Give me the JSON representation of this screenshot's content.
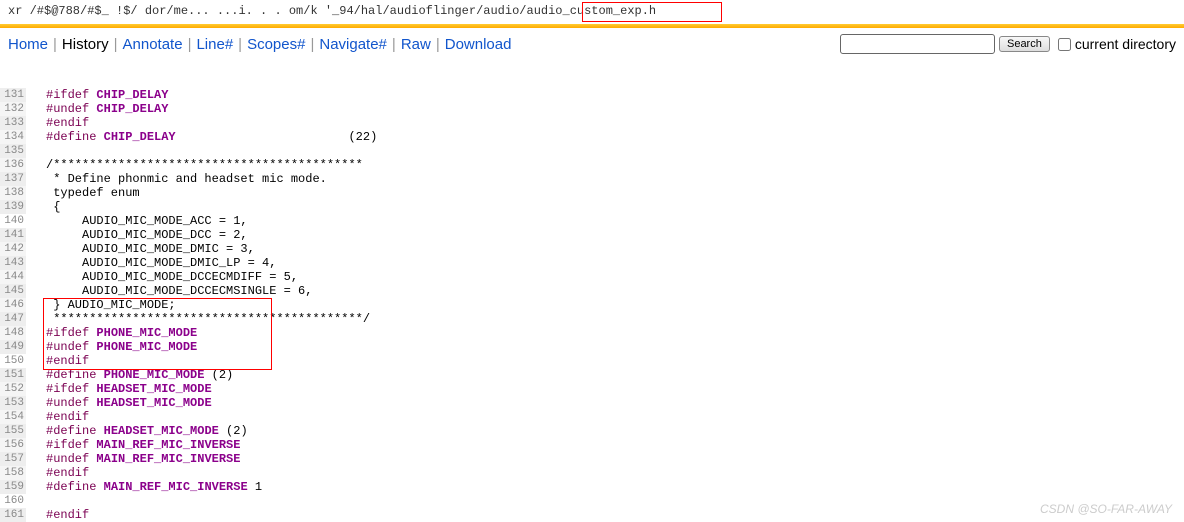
{
  "path": {
    "prefix": "xr   /#$@788/#$_ !$/   dor/me...  ...i.  . . om/k   '_94/hal/audioflinger/audio",
    "highlighted": "/audio_custom_exp.h"
  },
  "nav": {
    "items": [
      "Home",
      "History",
      "Annotate",
      "Line#",
      "Scopes#",
      "Navigate#",
      "Raw",
      "Download"
    ],
    "active_index": 1
  },
  "search": {
    "button": "Search",
    "checkbox_label": "current directory"
  },
  "code_lines": [
    {
      "n": 131,
      "bg": "odd",
      "html": "<span class='kw'>#ifdef</span> <span class='macro'>CHIP_DELAY</span>"
    },
    {
      "n": 132,
      "bg": "even",
      "html": "<span class='kw'>#undef</span> <span class='macro'>CHIP_DELAY</span>"
    },
    {
      "n": 133,
      "bg": "odd",
      "html": "<span class='kw'>#endif</span>"
    },
    {
      "n": 134,
      "bg": "even",
      "html": "<span class='kw'>#define</span> <span class='macro'>CHIP_DELAY</span>                        (22)"
    },
    {
      "n": 135,
      "bg": "odd",
      "html": ""
    },
    {
      "n": 136,
      "bg": "even",
      "html": "/*******************************************"
    },
    {
      "n": 137,
      "bg": "odd",
      "html": " * Define phonmic and headset mic mode."
    },
    {
      "n": 138,
      "bg": "even",
      "html": " typedef enum"
    },
    {
      "n": 139,
      "bg": "odd",
      "html": " {"
    },
    {
      "n": 140,
      "bg": "white",
      "html": "     AUDIO_MIC_MODE_ACC = 1,"
    },
    {
      "n": 141,
      "bg": "odd",
      "html": "     AUDIO_MIC_MODE_DCC = 2,"
    },
    {
      "n": 142,
      "bg": "even",
      "html": "     AUDIO_MIC_MODE_DMIC = 3,"
    },
    {
      "n": 143,
      "bg": "odd",
      "html": "     AUDIO_MIC_MODE_DMIC_LP = 4,"
    },
    {
      "n": 144,
      "bg": "even",
      "html": "     AUDIO_MIC_MODE_DCCECMDIFF = 5,"
    },
    {
      "n": 145,
      "bg": "odd",
      "html": "     AUDIO_MIC_MODE_DCCECMSINGLE = 6,"
    },
    {
      "n": 146,
      "bg": "even",
      "html": " } AUDIO_MIC_MODE;"
    },
    {
      "n": 147,
      "bg": "odd",
      "html": " *******************************************/"
    },
    {
      "n": 148,
      "bg": "even",
      "html": "<span class='kw'>#ifdef</span> <span class='macro'>PHONE_MIC_MODE</span>"
    },
    {
      "n": 149,
      "bg": "odd",
      "html": "<span class='kw'>#undef</span> <span class='macro'>PHONE_MIC_MODE</span>"
    },
    {
      "n": 150,
      "bg": "white",
      "html": "<span class='kw'>#endif</span>"
    },
    {
      "n": 151,
      "bg": "odd",
      "html": "<span class='kw'>#define</span> <span class='macro'>PHONE_MIC_MODE</span> (2)"
    },
    {
      "n": 152,
      "bg": "even",
      "html": "<span class='kw'>#ifdef</span> <span class='macro'>HEADSET_MIC_MODE</span>"
    },
    {
      "n": 153,
      "bg": "odd",
      "html": "<span class='kw'>#undef</span> <span class='macro'>HEADSET_MIC_MODE</span>"
    },
    {
      "n": 154,
      "bg": "even",
      "html": "<span class='kw'>#endif</span>"
    },
    {
      "n": 155,
      "bg": "odd",
      "html": "<span class='kw'>#define</span> <span class='macro'>HEADSET_MIC_MODE</span> (2)"
    },
    {
      "n": 156,
      "bg": "even",
      "html": "<span class='kw'>#ifdef</span> <span class='macro'>MAIN_REF_MIC_INVERSE</span>"
    },
    {
      "n": 157,
      "bg": "odd",
      "html": "<span class='kw'>#undef</span> <span class='macro'>MAIN_REF_MIC_INVERSE</span>"
    },
    {
      "n": 158,
      "bg": "even",
      "html": "<span class='kw'>#endif</span>"
    },
    {
      "n": 159,
      "bg": "odd",
      "html": "<span class='kw'>#define</span> <span class='macro'>MAIN_REF_MIC_INVERSE</span> 1"
    },
    {
      "n": 160,
      "bg": "white",
      "html": ""
    },
    {
      "n": 161,
      "bg": "odd",
      "html": "<span class='kw'>#endif</span>"
    }
  ],
  "watermark": "CSDN @SO-FAR-AWAY"
}
